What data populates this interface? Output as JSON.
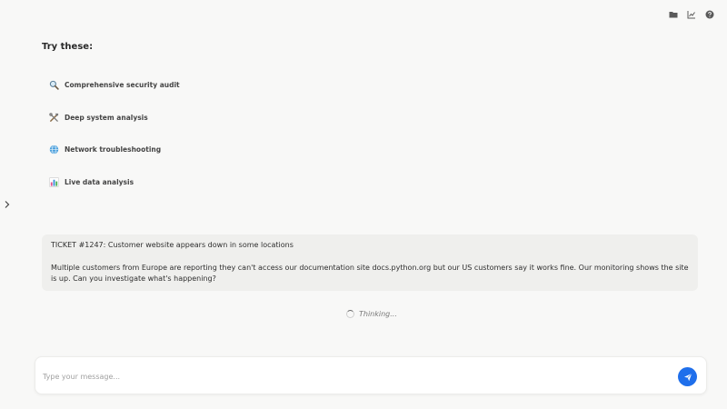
{
  "toolbar": {
    "icons": [
      "folder-icon",
      "chart-line-icon",
      "help-icon"
    ]
  },
  "sidebar": {
    "toggle_icon": "chevron-right-icon"
  },
  "suggestions": {
    "heading": "Try these:",
    "items": [
      {
        "icon": "magnifier-icon",
        "label": "Comprehensive security audit"
      },
      {
        "icon": "tools-icon",
        "label": "Deep system analysis"
      },
      {
        "icon": "globe-icon",
        "label": "Network troubleshooting"
      },
      {
        "icon": "bar-chart-icon",
        "label": "Live data analysis"
      }
    ]
  },
  "message": {
    "title": "TICKET #1247: Customer website appears down in some locations",
    "body": "Multiple customers from Europe are reporting they can't access our documentation site docs.python.org but our US customers say it works fine. Our monitoring shows the site is up. Can you investigate what's happening?"
  },
  "status": {
    "thinking": "Thinking..."
  },
  "composer": {
    "placeholder": "Type your message...",
    "value": "",
    "send_icon": "send-icon"
  },
  "colors": {
    "background": "#f8f8f7",
    "card": "#efefed",
    "accent": "#1f6feb"
  }
}
